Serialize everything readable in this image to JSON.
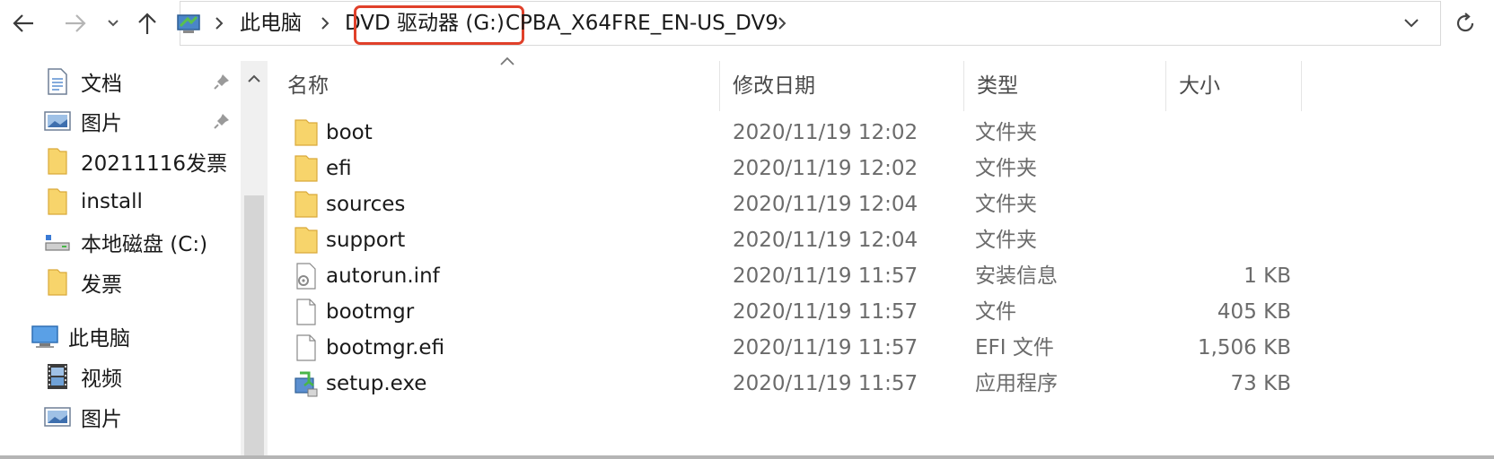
{
  "address_bar": {
    "crumbs": [
      {
        "label": "此电脑"
      },
      {
        "label": "DVD 驱动器 (G:)"
      },
      {
        "label": "CPBA_X64FRE_EN-US_DV9"
      }
    ]
  },
  "nav_pane": {
    "items": [
      {
        "label": "文档",
        "icon": "document-icon",
        "pinned": true
      },
      {
        "label": "图片",
        "icon": "picture-icon",
        "pinned": true
      },
      {
        "label": "20211116发票",
        "icon": "folder-icon",
        "pinned": false
      },
      {
        "label": "install",
        "icon": "folder-icon",
        "pinned": false
      },
      {
        "label": "本地磁盘 (C:)",
        "icon": "drive-icon",
        "pinned": false
      },
      {
        "label": "发票",
        "icon": "folder-icon",
        "pinned": false
      },
      {
        "label": "此电脑",
        "icon": "computer-icon",
        "pinned": false
      },
      {
        "label": "视频",
        "icon": "video-icon",
        "pinned": false
      },
      {
        "label": "图片",
        "icon": "picture-icon",
        "pinned": false
      }
    ]
  },
  "columns": {
    "name": "名称",
    "date": "修改日期",
    "type": "类型",
    "size": "大小"
  },
  "files": [
    {
      "name": "boot",
      "date": "2020/11/19 12:02",
      "type": "文件夹",
      "size": "",
      "icon": "folder-icon"
    },
    {
      "name": "efi",
      "date": "2020/11/19 12:02",
      "type": "文件夹",
      "size": "",
      "icon": "folder-icon"
    },
    {
      "name": "sources",
      "date": "2020/11/19 12:04",
      "type": "文件夹",
      "size": "",
      "icon": "folder-icon"
    },
    {
      "name": "support",
      "date": "2020/11/19 12:04",
      "type": "文件夹",
      "size": "",
      "icon": "folder-icon"
    },
    {
      "name": "autorun.inf",
      "date": "2020/11/19 11:57",
      "type": "安装信息",
      "size": "1 KB",
      "icon": "settings-file-icon"
    },
    {
      "name": "bootmgr",
      "date": "2020/11/19 11:57",
      "type": "文件",
      "size": "405 KB",
      "icon": "file-icon"
    },
    {
      "name": "bootmgr.efi",
      "date": "2020/11/19 11:57",
      "type": "EFI 文件",
      "size": "1,506 KB",
      "icon": "file-icon"
    },
    {
      "name": "setup.exe",
      "date": "2020/11/19 11:57",
      "type": "应用程序",
      "size": "73 KB",
      "icon": "setup-app-icon"
    }
  ],
  "colors": {
    "highlight_box": "#e0402a",
    "folder_yellow": "#f7d46b"
  }
}
